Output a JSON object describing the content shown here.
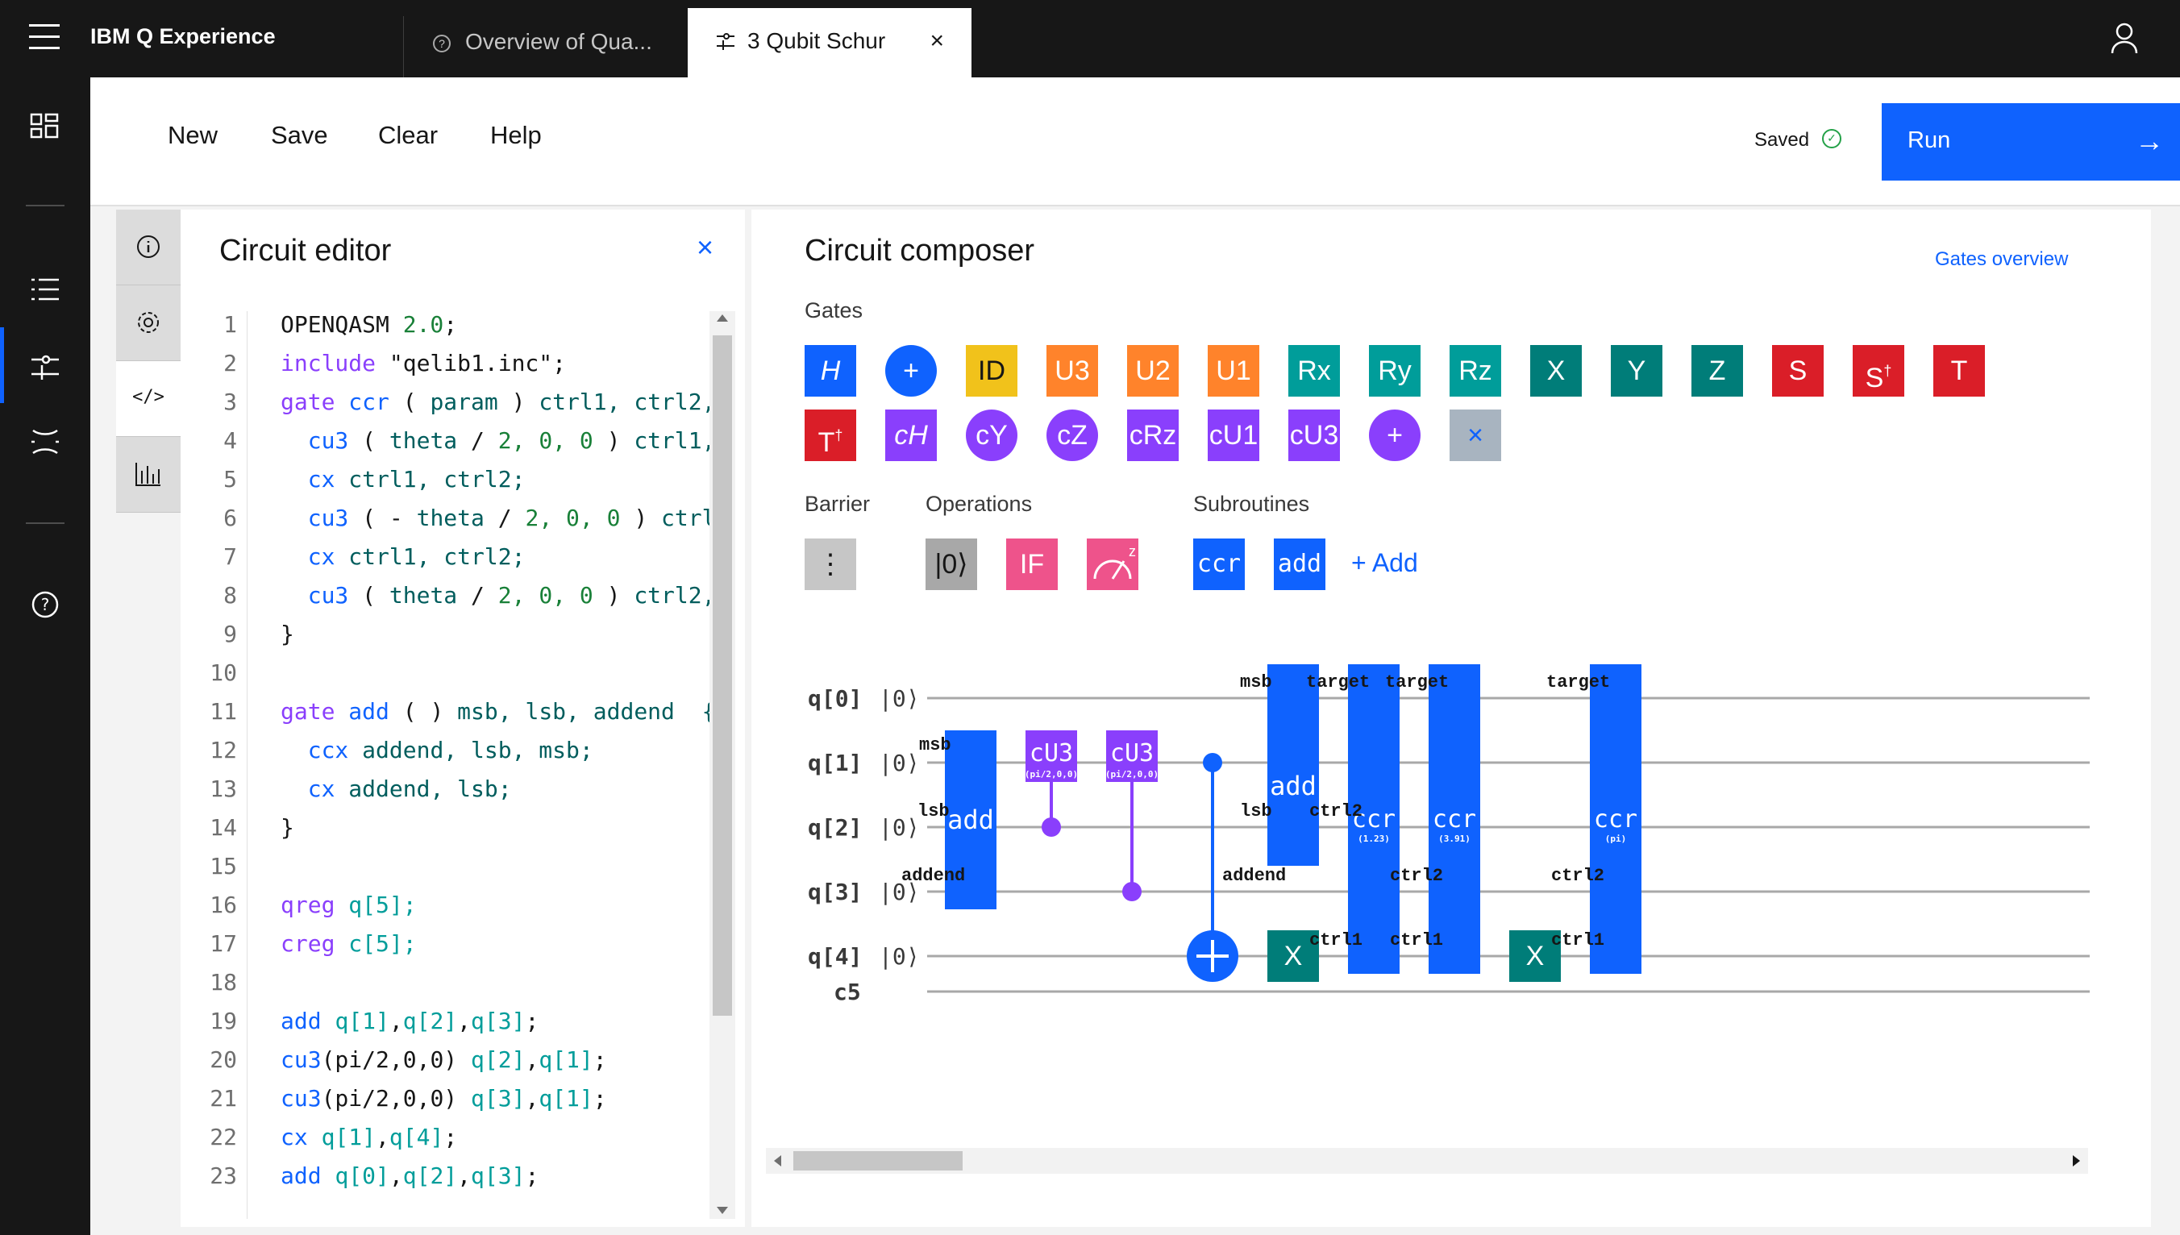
{
  "app": {
    "title": "IBM Q Experience"
  },
  "tabs": [
    {
      "label": "Overview of Qua..."
    },
    {
      "label": "3 Qubit Schur"
    }
  ],
  "toolbar": {
    "new": "New",
    "save": "Save",
    "clear": "Clear",
    "help": "Help",
    "status": "Saved",
    "run": "Run"
  },
  "editor": {
    "title": "Circuit editor",
    "lines": [
      [
        [
          "OPENQASM ",
          "str"
        ],
        [
          "2.0",
          "num"
        ],
        [
          ";",
          "str"
        ]
      ],
      [
        [
          "include ",
          "kw"
        ],
        [
          "\"qelib1.inc\";",
          "str"
        ]
      ],
      [
        [
          "gate ",
          "kw"
        ],
        [
          "ccr ",
          "fn"
        ],
        [
          "( ",
          "str"
        ],
        [
          "param ",
          "id"
        ],
        [
          ") ",
          "str"
        ],
        [
          "ctrl1, ctrl2,",
          "id"
        ]
      ],
      [
        [
          "  cu3 ",
          "fn"
        ],
        [
          "( ",
          "str"
        ],
        [
          "theta ",
          "id"
        ],
        [
          "/ ",
          "str"
        ],
        [
          "2, 0, 0 ",
          "num"
        ],
        [
          ") ",
          "str"
        ],
        [
          "ctrl1,",
          "id"
        ]
      ],
      [
        [
          "  cx ",
          "fn"
        ],
        [
          "ctrl1, ctrl2;",
          "id"
        ]
      ],
      [
        [
          "  cu3 ",
          "fn"
        ],
        [
          "( - ",
          "str"
        ],
        [
          "theta ",
          "id"
        ],
        [
          "/ ",
          "str"
        ],
        [
          "2, 0, 0 ",
          "num"
        ],
        [
          ") ",
          "str"
        ],
        [
          "ctrl",
          "id"
        ]
      ],
      [
        [
          "  cx ",
          "fn"
        ],
        [
          "ctrl1, ctrl2;",
          "id"
        ]
      ],
      [
        [
          "  cu3 ",
          "fn"
        ],
        [
          "( ",
          "str"
        ],
        [
          "theta ",
          "id"
        ],
        [
          "/ ",
          "str"
        ],
        [
          "2, 0, 0 ",
          "num"
        ],
        [
          ") ",
          "str"
        ],
        [
          "ctrl2,",
          "id"
        ]
      ],
      [
        [
          "}",
          "str"
        ]
      ],
      [],
      [
        [
          "gate ",
          "kw"
        ],
        [
          "add ",
          "fn"
        ],
        [
          "( ) ",
          "str"
        ],
        [
          "msb, lsb, addend  {",
          "id"
        ]
      ],
      [
        [
          "  ccx ",
          "fn"
        ],
        [
          "addend, lsb, msb;",
          "id"
        ]
      ],
      [
        [
          "  cx ",
          "fn"
        ],
        [
          "addend, lsb;",
          "id"
        ]
      ],
      [
        [
          "}",
          "str"
        ]
      ],
      [],
      [
        [
          "qreg ",
          "kw"
        ],
        [
          "q[5];",
          "reg"
        ]
      ],
      [
        [
          "creg ",
          "kw"
        ],
        [
          "c[5];",
          "reg"
        ]
      ],
      [],
      [
        [
          "add ",
          "fn"
        ],
        [
          "q[1]",
          "reg"
        ],
        [
          ",",
          "str"
        ],
        [
          "q[2]",
          "reg"
        ],
        [
          ",",
          "str"
        ],
        [
          "q[3]",
          "reg"
        ],
        [
          ";",
          "str"
        ]
      ],
      [
        [
          "cu3",
          "fn"
        ],
        [
          "(pi/2,0,0) ",
          "str"
        ],
        [
          "q[2]",
          "reg"
        ],
        [
          ",",
          "str"
        ],
        [
          "q[1]",
          "reg"
        ],
        [
          ";",
          "str"
        ]
      ],
      [
        [
          "cu3",
          "fn"
        ],
        [
          "(pi/2,0,0) ",
          "str"
        ],
        [
          "q[3]",
          "reg"
        ],
        [
          ",",
          "str"
        ],
        [
          "q[1]",
          "reg"
        ],
        [
          ";",
          "str"
        ]
      ],
      [
        [
          "cx ",
          "fn"
        ],
        [
          "q[1]",
          "reg"
        ],
        [
          ",",
          "str"
        ],
        [
          "q[4]",
          "reg"
        ],
        [
          ";",
          "str"
        ]
      ],
      [
        [
          "add ",
          "fn"
        ],
        [
          "q[0]",
          "reg"
        ],
        [
          ",",
          "str"
        ],
        [
          "q[2]",
          "reg"
        ],
        [
          ",",
          "str"
        ],
        [
          "q[3]",
          "reg"
        ],
        [
          ";",
          "str"
        ]
      ]
    ]
  },
  "composer": {
    "title": "Circuit composer",
    "gates_overview": "Gates overview",
    "gates_label": "Gates",
    "barrier_label": "Barrier",
    "operations_label": "Operations",
    "subroutines_label": "Subroutines",
    "add_subroutine": "+ Add",
    "gates_row1": [
      {
        "label": "H",
        "color": "#0f62fe",
        "shape": "square",
        "italic": true
      },
      {
        "label": "+",
        "color": "#0f62fe",
        "shape": "round"
      },
      {
        "label": "ID",
        "color": "#f1c21b",
        "shape": "square",
        "dark": true
      },
      {
        "label": "U3",
        "color": "#ff832b",
        "shape": "square"
      },
      {
        "label": "U2",
        "color": "#ff832b",
        "shape": "square"
      },
      {
        "label": "U1",
        "color": "#ff832b",
        "shape": "square"
      },
      {
        "label": "Rx",
        "color": "#009d9a",
        "shape": "square"
      },
      {
        "label": "Ry",
        "color": "#009d9a",
        "shape": "square"
      },
      {
        "label": "Rz",
        "color": "#009d9a",
        "shape": "square"
      },
      {
        "label": "X",
        "color": "#007d79",
        "shape": "square"
      },
      {
        "label": "Y",
        "color": "#007d79",
        "shape": "square"
      },
      {
        "label": "Z",
        "color": "#007d79",
        "shape": "square"
      },
      {
        "label": "S",
        "color": "#da1e28",
        "shape": "square"
      },
      {
        "label": "S",
        "sup": "†",
        "color": "#da1e28",
        "shape": "square"
      },
      {
        "label": "T",
        "color": "#da1e28",
        "shape": "square"
      }
    ],
    "gates_row2": [
      {
        "label": "T",
        "sup": "†",
        "color": "#da1e28",
        "shape": "square"
      },
      {
        "label": "cH",
        "color": "#8a3ffc",
        "shape": "square",
        "italic": true
      },
      {
        "label": "cY",
        "color": "#8a3ffc",
        "shape": "round"
      },
      {
        "label": "cZ",
        "color": "#8a3ffc",
        "shape": "round"
      },
      {
        "label": "cRz",
        "color": "#8a3ffc",
        "shape": "square"
      },
      {
        "label": "cU1",
        "color": "#8a3ffc",
        "shape": "square"
      },
      {
        "label": "cU3",
        "color": "#8a3ffc",
        "shape": "square"
      },
      {
        "label": "+",
        "color": "#8a3ffc",
        "shape": "round"
      },
      {
        "label": "×",
        "color": "#a8b4c0",
        "shape": "square",
        "swap": true
      }
    ],
    "operations": [
      {
        "label": "|0⟩",
        "color": "#a8a8a8",
        "dark": true
      },
      {
        "label": "IF",
        "color": "#ee538b"
      },
      {
        "label": "z",
        "color": "#ee538b",
        "measure": true
      }
    ],
    "subroutines": [
      {
        "label": "ccr",
        "color": "#0f62fe"
      },
      {
        "label": "add",
        "color": "#0f62fe"
      }
    ],
    "circuit": {
      "qubits": [
        "q[0]",
        "q[1]",
        "q[2]",
        "q[3]",
        "q[4]"
      ],
      "ket": "|0⟩",
      "classical": "c5",
      "add_label": "add",
      "cu3_label": "cU3",
      "cu3_param": "(pi/2,0,0)",
      "ccr_label": "ccr",
      "ccr_params": [
        "(1.23)",
        "(3.91)",
        "(pi)"
      ],
      "x_label": "X",
      "port_labels": {
        "msb": "msb",
        "lsb": "lsb",
        "addend": "addend",
        "target": "target",
        "ctrl1": "ctrl1",
        "ctrl2": "ctrl2"
      }
    }
  },
  "icons": [
    "menu-icon",
    "user-icon",
    "dashboard-icon",
    "list-icon",
    "composer-icon",
    "circuit-icon",
    "help-icon",
    "info-icon",
    "settings-icon",
    "code-icon",
    "chart-icon",
    "close-icon",
    "arrow-right-icon",
    "check-circle-icon"
  ]
}
